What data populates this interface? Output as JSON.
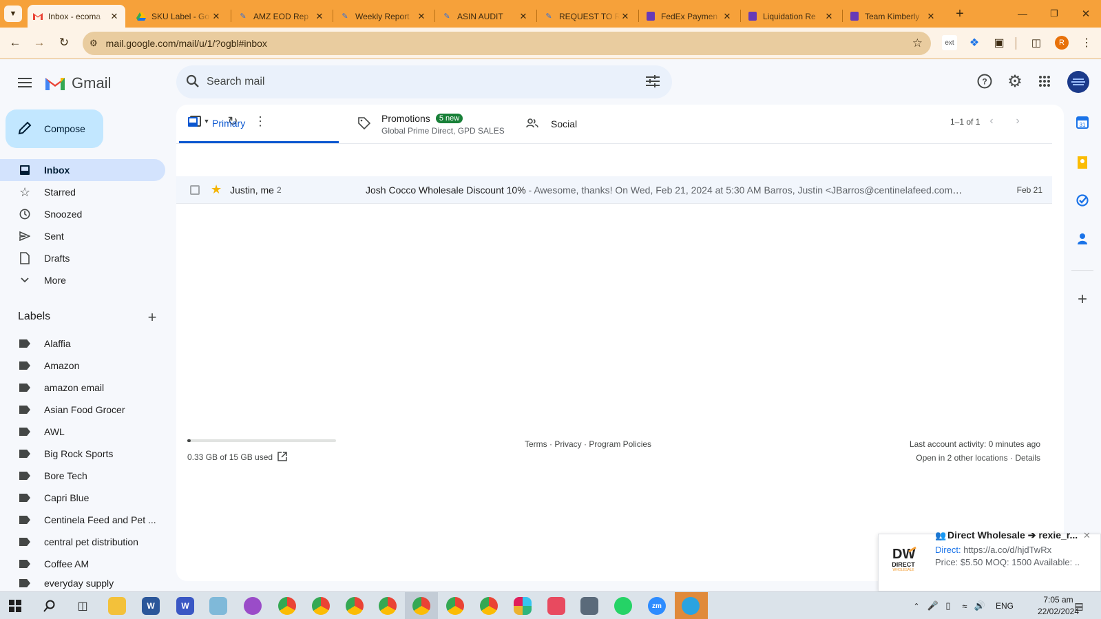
{
  "browser": {
    "tabs": [
      {
        "title": "Inbox - ecoma",
        "favicon": "gmail-icon",
        "color": "#ea4335"
      },
      {
        "title": "SKU Label - Go",
        "favicon": "drive-icon",
        "color": "#1a73e8"
      },
      {
        "title": "AMZ EOD Rep",
        "favicon": "pen-icon",
        "color": "#2f6fdc"
      },
      {
        "title": "Weekly Report",
        "favicon": "pen-icon",
        "color": "#2f6fdc"
      },
      {
        "title": "ASIN AUDIT",
        "favicon": "pen-icon",
        "color": "#2f6fdc"
      },
      {
        "title": "REQUEST TO R",
        "favicon": "pen-icon",
        "color": "#2f6fdc"
      },
      {
        "title": "FedEx Paymen",
        "favicon": "form-icon",
        "color": "#673ab7"
      },
      {
        "title": "Liquidation Re",
        "favicon": "form-icon",
        "color": "#673ab7"
      },
      {
        "title": "Team Kimberly",
        "favicon": "form-icon",
        "color": "#673ab7"
      }
    ],
    "url": "mail.google.com/mail/u/1/?ogbl#inbox",
    "profile_initial": "R"
  },
  "gmail": {
    "logo_text": "Gmail",
    "search_placeholder": "Search mail",
    "compose_label": "Compose",
    "nav": [
      {
        "label": "Inbox",
        "icon": "inbox-icon",
        "active": true
      },
      {
        "label": "Starred",
        "icon": "star-icon"
      },
      {
        "label": "Snoozed",
        "icon": "clock-icon"
      },
      {
        "label": "Sent",
        "icon": "send-icon"
      },
      {
        "label": "Drafts",
        "icon": "draft-icon"
      },
      {
        "label": "More",
        "icon": "chevron-down-icon"
      }
    ],
    "labels_heading": "Labels",
    "labels": [
      "Alaffia",
      "Amazon",
      "amazon email",
      "Asian Food Grocer",
      "AWL",
      "Big Rock Sports",
      "Bore Tech",
      "Capri Blue",
      "Centinela Feed and Pet ...",
      "central pet distribution",
      "Coffee AM",
      "everyday supply"
    ],
    "pagination": "1–1 of 1",
    "tabs": {
      "primary": "Primary",
      "promotions": "Promotions",
      "promotions_badge": "5 new",
      "promotions_sub": "Global Prime Direct, GPD SALES",
      "social": "Social"
    },
    "email": {
      "sender": "Justin, me",
      "count": "2",
      "subject": "Josh Cocco Wholesale Discount 10%",
      "snippet": " - Awesome, thanks! On Wed, Feb 21, 2024 at 5:30 AM Barros, Justin <JBarros@centinelafeed.com> w...",
      "date": "Feb 21",
      "starred": true
    },
    "storage": {
      "text": "0.33 GB of 15 GB used",
      "fraction": 0.022
    },
    "footer_links": "Terms · Privacy · Program Policies",
    "activity": {
      "line1": "Last account activity: 0 minutes ago",
      "line2": "Open in 2 other locations · Details"
    },
    "toast": {
      "title": "Direct Wholesale ➔ rexie_r...",
      "link_label": "Direct:",
      "link": "https://a.co/d/hjdTwRx",
      "details": "Price: $5.50 MOQ: 1500 Available: ...",
      "logo_text": "DIRECT",
      "logo_sub": "WHOLESALE"
    }
  },
  "taskbar": {
    "time": "7:05 am",
    "date": "22/02/2024",
    "lang": "ENG"
  },
  "colors": {
    "tabstrip": "#f6a13a",
    "compose": "#c2e7ff",
    "active_nav": "#d3e3fd",
    "primary_blue": "#0b57d0",
    "promo_badge": "#188038"
  }
}
